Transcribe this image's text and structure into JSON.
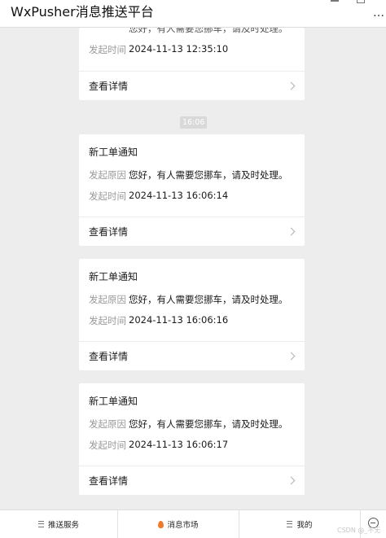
{
  "app": {
    "title": "WxPusher消息推送平台"
  },
  "header_icons": {
    "more": "…"
  },
  "timestamp_divider": "16:06",
  "labels": {
    "reason": "发起原因",
    "time": "发起时间",
    "view_detail": "查看详情"
  },
  "first_card": {
    "cut_text": "您好，有人需要您挪车，请及时处理。",
    "time_value": "2024-11-13 12:35:10"
  },
  "cards": [
    {
      "title": "新工单通知",
      "reason": "您好，有人需要您挪车，请及时处理。",
      "time": "2024-11-13 16:06:14"
    },
    {
      "title": "新工单通知",
      "reason": "您好，有人需要您挪车，请及时处理。",
      "time": "2024-11-13 16:06:16"
    },
    {
      "title": "新工单通知",
      "reason": "您好，有人需要您挪车，请及时处理。",
      "time": "2024-11-13 16:06:17"
    }
  ],
  "bottom_tabs": [
    {
      "label": "推送服务",
      "icon": "menu-icon"
    },
    {
      "label": "消息市场",
      "icon": "flame-icon"
    },
    {
      "label": "我的",
      "icon": "menu-icon"
    }
  ],
  "watermark": "CSDN @_不无"
}
